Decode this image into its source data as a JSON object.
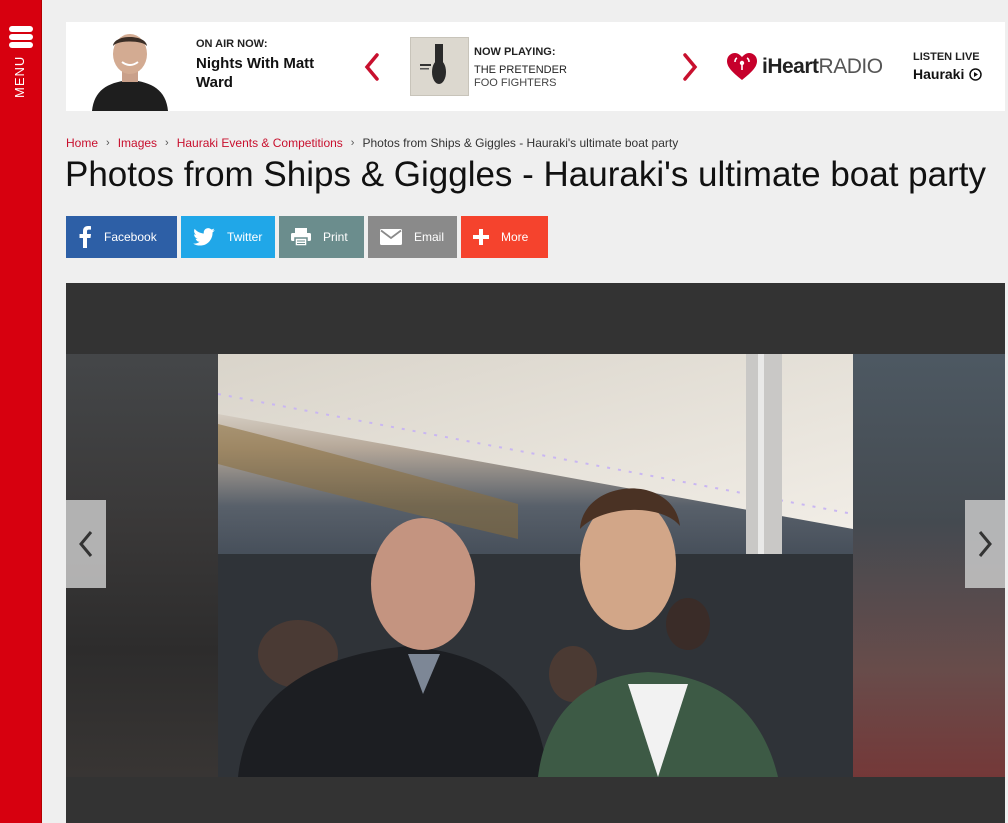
{
  "menu": {
    "label": "MENU"
  },
  "on_air": {
    "label": "ON AIR NOW:",
    "show": "Nights With Matt Ward"
  },
  "now_playing": {
    "label": "NOW PLAYING:",
    "song": "THE PRETENDER",
    "artist": "FOO FIGHTERS"
  },
  "iheart": {
    "brand_bold": "iHeart",
    "brand_light": "RADIO"
  },
  "listen_live": {
    "label": "LISTEN LIVE",
    "station": "Hauraki"
  },
  "breadcrumb": {
    "items": [
      "Home",
      "Images",
      "Hauraki Events & Competitions"
    ],
    "current": "Photos from Ships & Giggles - Hauraki's ultimate boat party"
  },
  "page_title": "Photos from Ships & Giggles - Hauraki's ultimate boat party",
  "share": {
    "facebook": "Facebook",
    "twitter": "Twitter",
    "print": "Print",
    "email": "Email",
    "more": "More"
  },
  "colors": {
    "brand_red": "#d7000f",
    "facebook": "#2d5fa6",
    "twitter": "#20a7e8",
    "print": "#6b8d8d",
    "email": "#8a8a8a",
    "more": "#f5432d"
  }
}
